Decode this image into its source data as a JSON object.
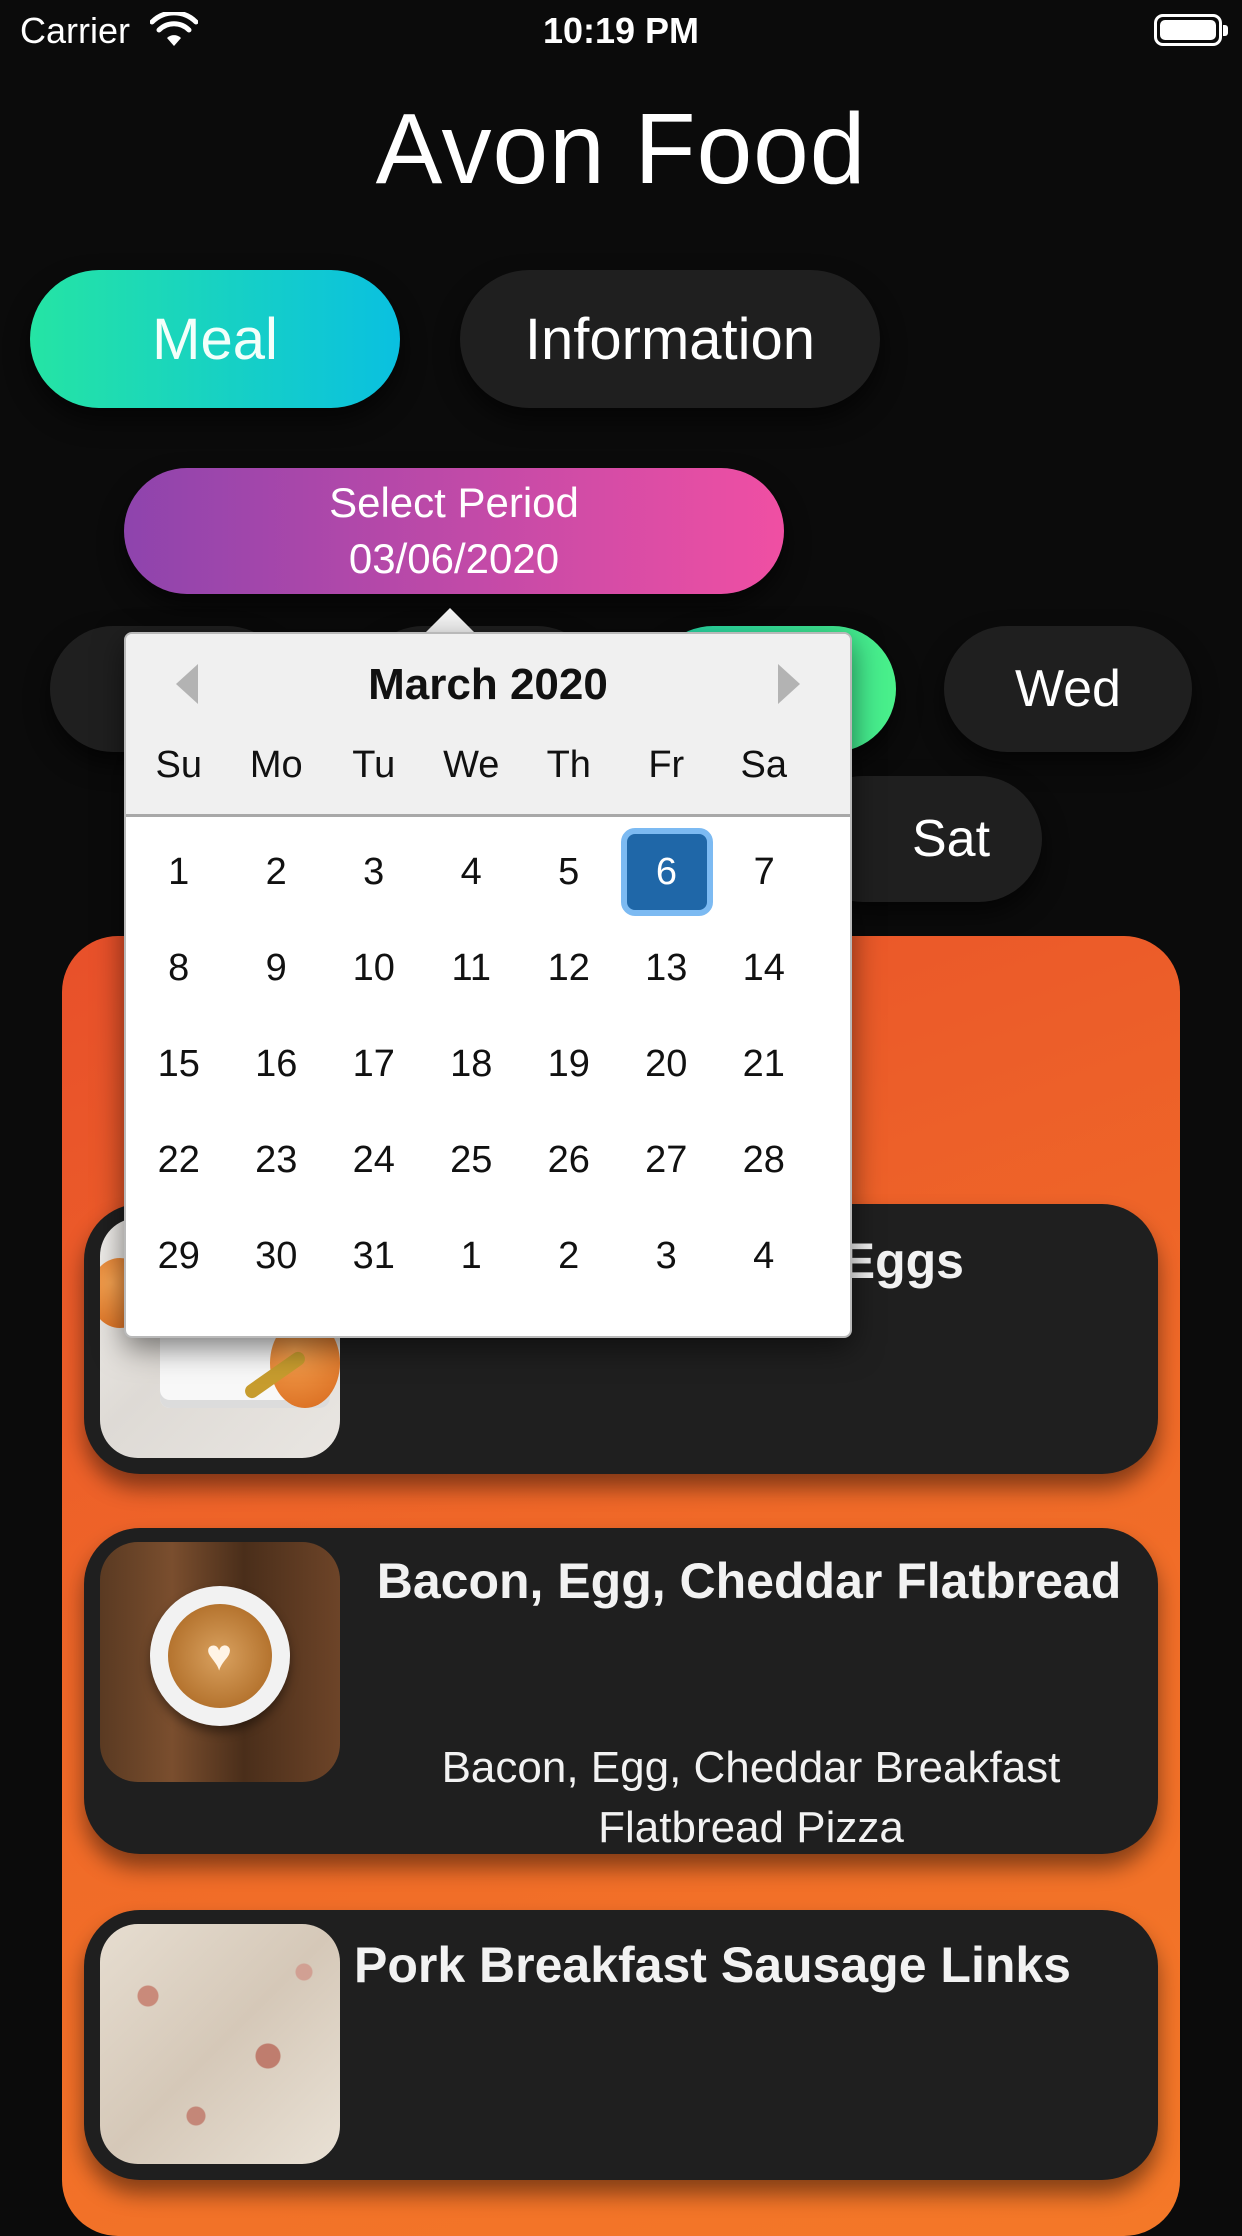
{
  "status_bar": {
    "carrier": "Carrier",
    "time": "10:19 PM"
  },
  "app": {
    "title": "Avon Food"
  },
  "tabs": [
    {
      "label": "Meal",
      "active": true
    },
    {
      "label": "Information",
      "active": false
    }
  ],
  "period": {
    "label": "Select Period",
    "date": "03/06/2020"
  },
  "weekdays": {
    "wed": "Wed",
    "sat": "Sat"
  },
  "meals": [
    {
      "title": "Eggs",
      "description": ""
    },
    {
      "title": "Bacon, Egg, Cheddar Flatbread",
      "description": "Bacon, Egg, Cheddar Breakfast Flatbread Pizza"
    },
    {
      "title": "Pork Breakfast Sausage Links",
      "description": ""
    }
  ],
  "calendar": {
    "month_title": "March 2020",
    "weekday_headers": [
      "Su",
      "Mo",
      "Tu",
      "We",
      "Th",
      "Fr",
      "Sa"
    ],
    "weeks": [
      [
        "1",
        "2",
        "3",
        "4",
        "5",
        "6",
        "7"
      ],
      [
        "8",
        "9",
        "10",
        "11",
        "12",
        "13",
        "14"
      ],
      [
        "15",
        "16",
        "17",
        "18",
        "19",
        "20",
        "21"
      ],
      [
        "22",
        "23",
        "24",
        "25",
        "26",
        "27",
        "28"
      ],
      [
        "29",
        "30",
        "31",
        "1",
        "2",
        "3",
        "4"
      ]
    ],
    "selected_day": "6"
  },
  "colors": {
    "meal_tab_gradient": [
      "#25e4a4",
      "#0ac0e0"
    ],
    "period_gradient": [
      "#8e44ad",
      "#f04fa3"
    ],
    "card_orange": "#f06a28",
    "selected_day": "#1f67a8"
  }
}
